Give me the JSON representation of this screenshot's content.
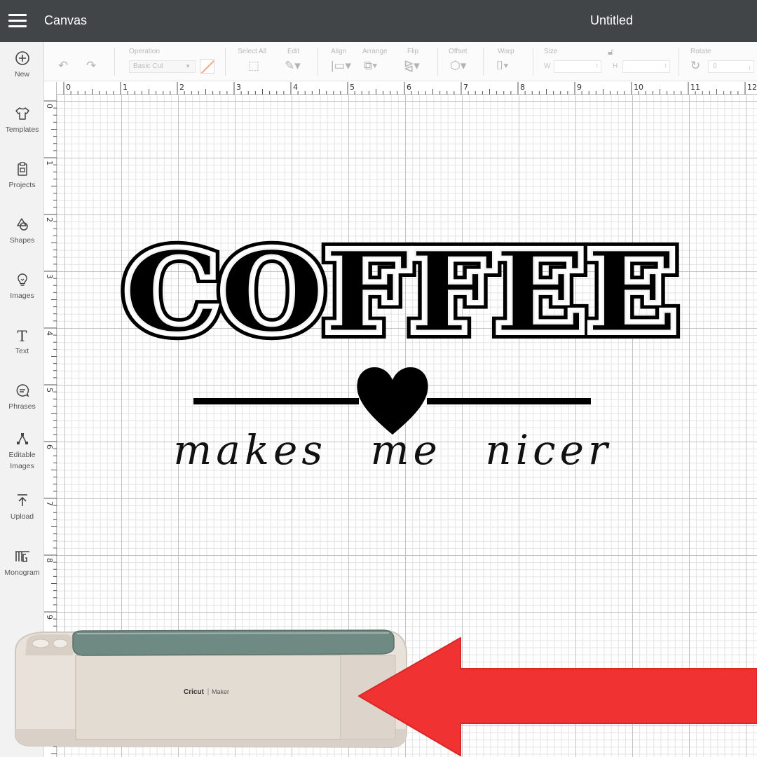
{
  "header": {
    "app_title": "Canvas",
    "doc_title": "Untitled"
  },
  "sidebar": {
    "items": [
      {
        "label": "New",
        "icon": "plus-circle-icon"
      },
      {
        "label": "Templates",
        "icon": "shirt-icon"
      },
      {
        "label": "Projects",
        "icon": "clipboard-icon"
      },
      {
        "label": "Shapes",
        "icon": "shapes-icon"
      },
      {
        "label": "Images",
        "icon": "lightbulb-icon"
      },
      {
        "label": "Text",
        "icon": "text-icon"
      },
      {
        "label": "Phrases",
        "icon": "speech-bubble-icon"
      },
      {
        "label": "Editable\nImages",
        "icon": "editable-images-icon"
      },
      {
        "label": "Upload",
        "icon": "upload-icon"
      },
      {
        "label": "Monogram",
        "icon": "monogram-icon"
      }
    ]
  },
  "toolbar": {
    "operation_label": "Operation",
    "operation_value": "Basic Cut",
    "select_all_label": "Select All",
    "edit_label": "Edit",
    "align_label": "Align",
    "arrange_label": "Arrange",
    "flip_label": "Flip",
    "offset_label": "Offset",
    "warp_label": "Warp",
    "size_label": "Size",
    "width_letter": "W",
    "height_letter": "H",
    "rotate_label": "Rotate",
    "rotate_value": "0"
  },
  "ruler": {
    "top": [
      "0",
      "1",
      "2",
      "3",
      "4",
      "5",
      "6",
      "7",
      "8",
      "9",
      "10",
      "11",
      "12"
    ],
    "left": [
      "0",
      "1",
      "2",
      "3",
      "4",
      "5",
      "6",
      "7",
      "8",
      "9"
    ]
  },
  "design": {
    "headline": "COFFEE",
    "tagline": "makes me nicer"
  },
  "machine": {
    "brand": "Cricut",
    "model": "Maker"
  },
  "colors": {
    "header_bg": "#414548",
    "arrow": "#f03232",
    "machine_lid": "#6f8a82",
    "machine_body": "#e9e3dc"
  }
}
